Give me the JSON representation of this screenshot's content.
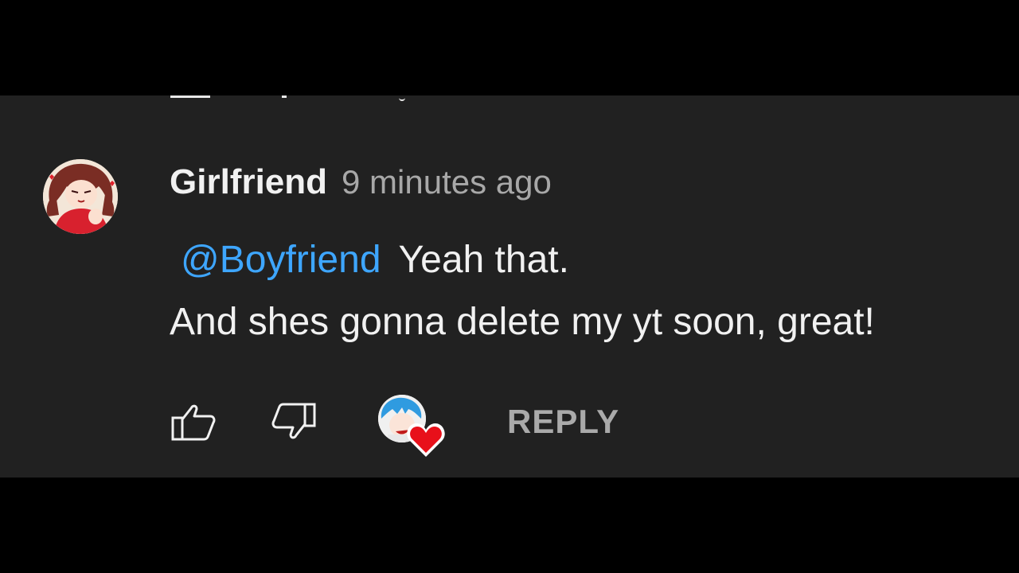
{
  "comment": {
    "author": "Girlfriend",
    "timestamp": "9 minutes ago",
    "mention": "@Boyfriend",
    "line1_text": "Yeah that.",
    "line2_text": "And shes gonna delete my yt soon, great!"
  },
  "actions": {
    "like_icon": "thumbs-up-icon",
    "dislike_icon": "thumbs-down-icon",
    "creator_heart_icon": "heart-icon",
    "reply_label": "REPLY"
  },
  "colors": {
    "background": "#212121",
    "letterbox": "#000000",
    "text_primary": "#f1f1f1",
    "text_secondary": "#a8a8a8",
    "mention": "#3ea6ff",
    "heart": "#e8101a"
  }
}
